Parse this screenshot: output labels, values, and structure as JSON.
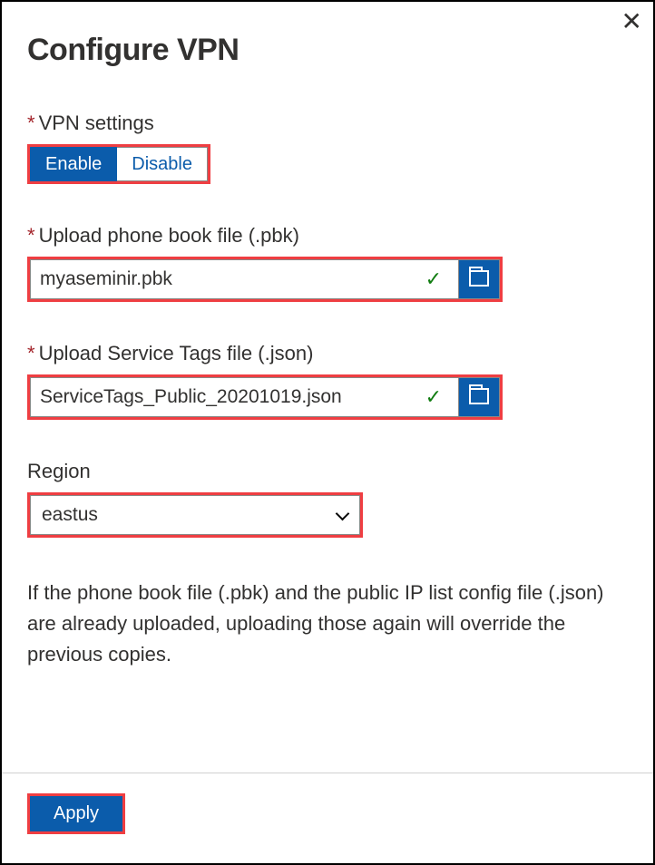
{
  "title": "Configure VPN",
  "close_label": "✕",
  "fields": {
    "vpn": {
      "label": "VPN settings",
      "required": true,
      "enable": "Enable",
      "disable": "Disable",
      "selected": "enable"
    },
    "pbk": {
      "label": "Upload phone book file (.pbk)",
      "required": true,
      "value": "myaseminir.pbk",
      "valid": true
    },
    "servicetags": {
      "label": "Upload Service Tags file (.json)",
      "required": true,
      "value": "ServiceTags_Public_20201019.json",
      "valid": true
    },
    "region": {
      "label": "Region",
      "required": false,
      "value": "eastus"
    }
  },
  "note": "If the phone book file (.pbk) and the public IP list config file (.json) are already uploaded, uploading those again will override the previous copies.",
  "footer": {
    "apply": "Apply"
  }
}
